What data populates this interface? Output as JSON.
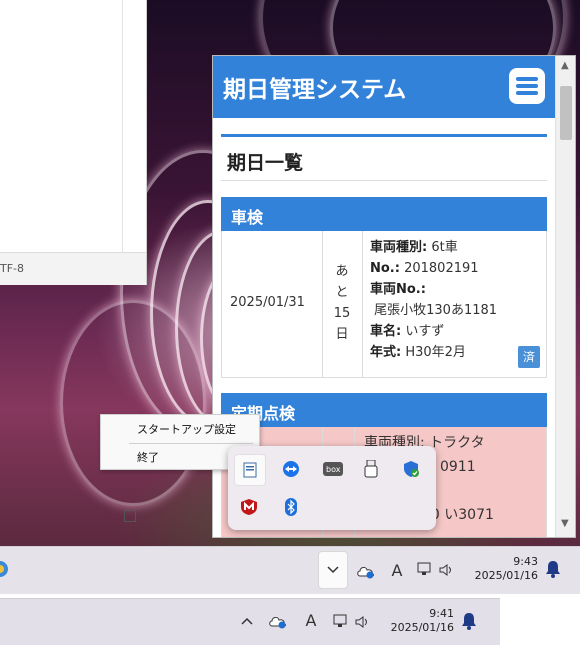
{
  "background_window": {
    "status_text": "TF-8"
  },
  "app": {
    "title": "期日管理システム",
    "section_title": "期日一覧",
    "cards": [
      {
        "category": "車検",
        "date": "2025/01/31",
        "remaining_chars": [
          "あ",
          "と",
          "15",
          "日"
        ],
        "fields": [
          {
            "label": "車両種別:",
            "value": "6t車"
          },
          {
            "label": "No.:",
            "value": "201802191"
          },
          {
            "label": "車両No.:",
            "value": ""
          },
          {
            "label": "",
            "value": "尾張小牧130あ1181"
          },
          {
            "label": "車名:",
            "value": "いすず"
          },
          {
            "label": "年式:",
            "value": "H30年2月"
          }
        ],
        "badge": "済"
      },
      {
        "category": "定期点検",
        "fields": [
          {
            "text": "車両種別: トラクタ"
          },
          {
            "text": "0911"
          },
          {
            "text": "30 い3071"
          }
        ]
      }
    ]
  },
  "context_menu": {
    "items": [
      "スタートアップ設定",
      "終了"
    ]
  },
  "tray_flyout": {
    "icons": [
      "notepad-icon",
      "teamviewer-icon",
      "box-icon",
      "usb-drive-icon",
      "defender-shield-icon",
      "mcafee-icon",
      "bluetooth-icon"
    ]
  },
  "taskbar_top": {
    "time": "9:43",
    "date": "2025/01/16",
    "ime": "A"
  },
  "taskbar_bottom": {
    "time": "9:41",
    "date": "2025/01/16",
    "ime": "A"
  },
  "colors": {
    "accent": "#3282d9",
    "alert_bg": "#f6c7c7"
  }
}
